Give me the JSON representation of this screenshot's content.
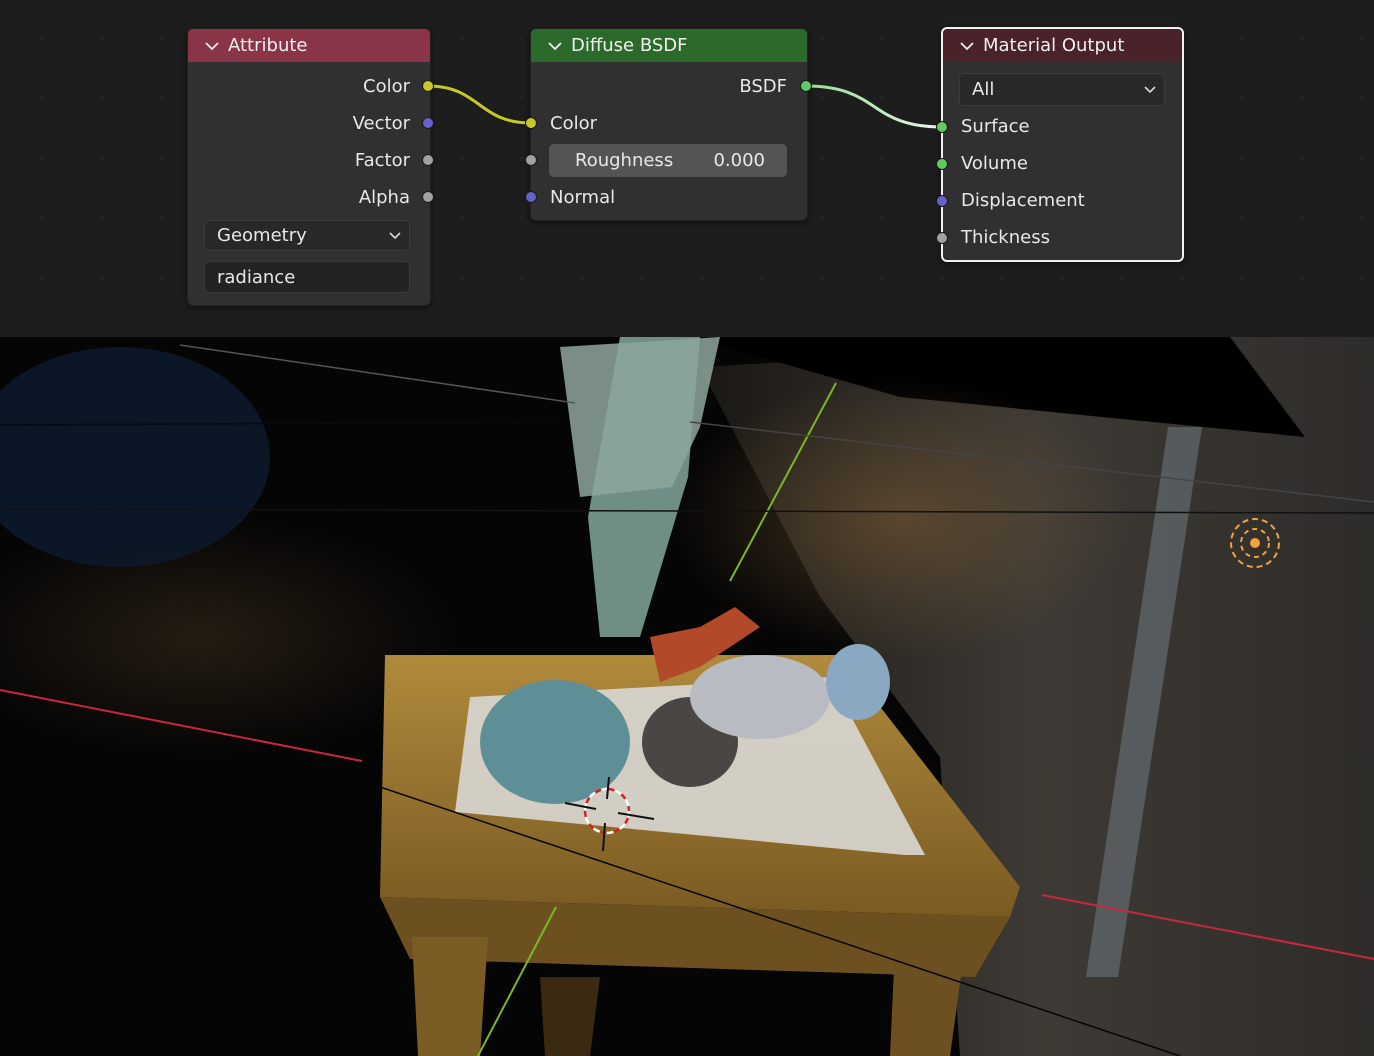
{
  "nodes": {
    "attribute": {
      "title": "Attribute",
      "header_color": "#8a3448",
      "outputs": [
        "Color",
        "Vector",
        "Factor",
        "Alpha"
      ],
      "type_select": "Geometry",
      "name_field": "radiance"
    },
    "diffuse": {
      "title": "Diffuse BSDF",
      "header_color": "#2c6a2c",
      "output": "BSDF",
      "inputs": {
        "color": "Color",
        "roughness_label": "Roughness",
        "roughness_value": "0.000",
        "normal": "Normal"
      }
    },
    "output": {
      "title": "Material Output",
      "header_color": "#4a2229",
      "target_select": "All",
      "inputs": [
        "Surface",
        "Volume",
        "Displacement",
        "Thickness"
      ]
    }
  },
  "socket_colors": {
    "color": "#c7c729",
    "vector": "#6363c7",
    "float": "#a1a1a1",
    "shader": "#63c763"
  },
  "viewport": {
    "axis_x_color": "#c8283c",
    "axis_y_color": "#7cb628",
    "light_color": "#f2a23a"
  }
}
